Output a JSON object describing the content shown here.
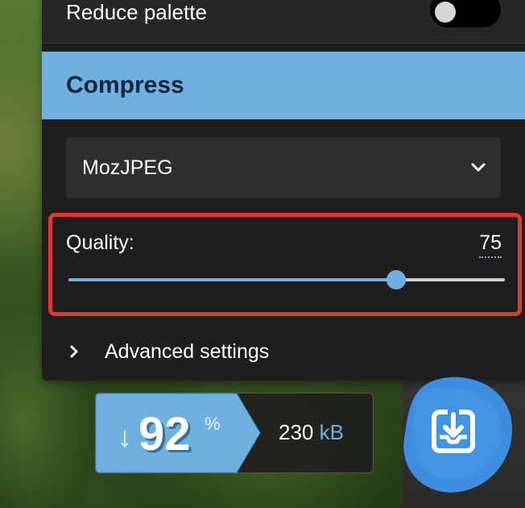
{
  "reduce_palette": {
    "label": "Reduce palette",
    "enabled": false
  },
  "compress": {
    "header": "Compress",
    "method": {
      "selected": "MozJPEG",
      "icon": "chevron-down-icon"
    },
    "quality": {
      "label": "Quality:",
      "value": "75",
      "min": 0,
      "max": 100
    },
    "advanced": {
      "label": "Advanced settings",
      "icon": "chevron-right-icon"
    }
  },
  "result": {
    "arrow": "↓",
    "percent": "92",
    "percent_unit": "%",
    "size_value": "230",
    "size_unit": "kB"
  },
  "download": {
    "icon": "download-icon"
  },
  "colors": {
    "accent": "#6fb0df",
    "panel": "#1e1e1e",
    "highlight_border": "#e0382b",
    "download_blob": "#3d8ee0"
  }
}
